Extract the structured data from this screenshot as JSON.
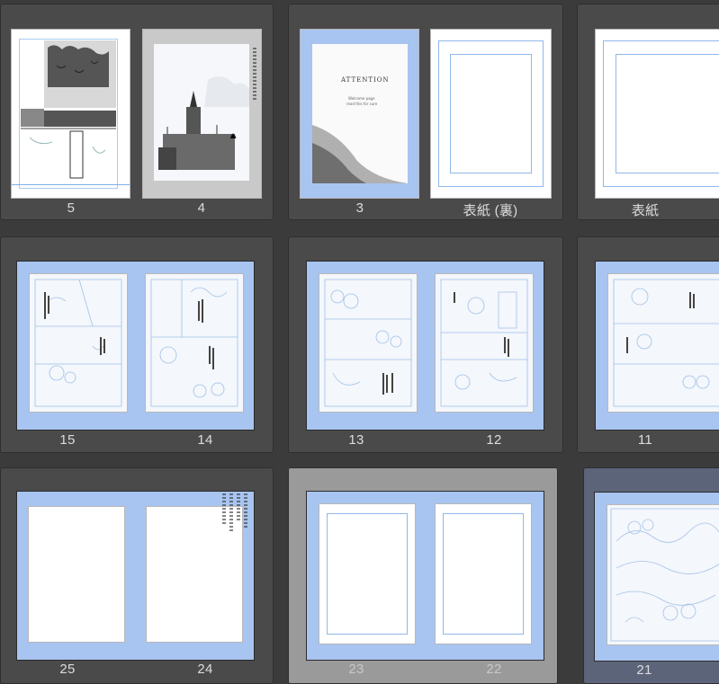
{
  "page_labels": {
    "r1c1_a": "5",
    "r1c1_b": "4",
    "r1c2_a": "3",
    "r1c2_b": "表紙 (裏)",
    "r1c3_a": "表紙",
    "r2c1_a": "15",
    "r2c1_b": "14",
    "r2c2_a": "13",
    "r2c2_b": "12",
    "r2c3_a": "11",
    "r3c1_a": "25",
    "r3c1_b": "24",
    "r3c2_a": "23",
    "r3c2_b": "22",
    "r3c3_a": "21"
  },
  "cover": {
    "title": "ATTENTION",
    "line1": "Welcome page",
    "line2": "read this for sure"
  },
  "colors": {
    "workspace": "#3b3b3b",
    "cell": "#4a4a4a",
    "selected_gray": "#9a9a9a",
    "selected_slate": "#5b6478",
    "spread_blue": "#a8c4f0",
    "guide": "#8fb8e8"
  }
}
